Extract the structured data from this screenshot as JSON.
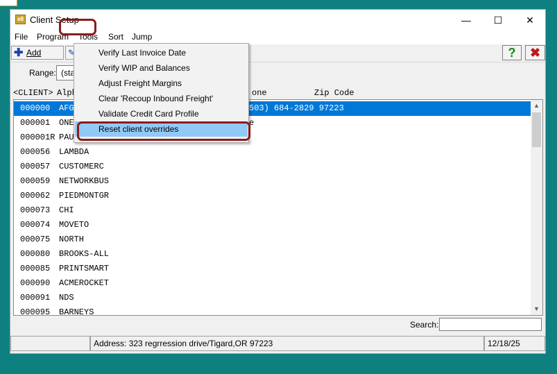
{
  "window": {
    "title": "Client Setup",
    "icon_text": "e8",
    "controls": {
      "minimize": "—",
      "maximize": "☐",
      "close": "✕"
    }
  },
  "menubar": [
    "File",
    "Program",
    "Tools",
    "Sort",
    "Jump"
  ],
  "toolbar": {
    "add_label": "Add",
    "add_icon": "plus-icon",
    "help_icon": "?",
    "close_icon": "✖"
  },
  "range": {
    "label": "Range:",
    "value": "(sta"
  },
  "columns": {
    "client": "<CLIENT>",
    "alpha": "Alph",
    "phone": "one",
    "zip": "Zip Code"
  },
  "rows": [
    {
      "code": "000000",
      "alpha": "AFG",
      "phone": "503) 684-2829 97223",
      "selected": true
    },
    {
      "code": "000001",
      "alpha": "ONE",
      "phone": "e"
    },
    {
      "code": "000001R",
      "alpha": "PAUL",
      "phone": ""
    },
    {
      "code": "000056",
      "alpha": "LAMBDA",
      "phone": ""
    },
    {
      "code": "000057",
      "alpha": "CUSTOMERC",
      "phone": ""
    },
    {
      "code": "000059",
      "alpha": "NETWORKBUS",
      "phone": ""
    },
    {
      "code": "000062",
      "alpha": "PIEDMONTGR",
      "phone": ""
    },
    {
      "code": "000073",
      "alpha": "CHI",
      "phone": ""
    },
    {
      "code": "000074",
      "alpha": "MOVETO",
      "phone": ""
    },
    {
      "code": "000075",
      "alpha": "NORTH",
      "phone": ""
    },
    {
      "code": "000080",
      "alpha": "BROOKS-ALL",
      "phone": ""
    },
    {
      "code": "000085",
      "alpha": "PRINTSMART",
      "phone": ""
    },
    {
      "code": "000090",
      "alpha": "ACMEROCKET",
      "phone": ""
    },
    {
      "code": "000091",
      "alpha": "NDS",
      "phone": ""
    },
    {
      "code": "000095",
      "alpha": "BARNEYS",
      "phone": ""
    }
  ],
  "tools_menu": [
    "Verify Last Invoice Date",
    "Verify WIP and Balances",
    "Adjust Freight Margins",
    "Clear 'Recoup Inbound Freight'",
    "Validate Credit Card Profile",
    "Reset client overrides"
  ],
  "search": {
    "label": "Search:",
    "value": ""
  },
  "status": {
    "left": "",
    "address": "Address: 323 regrression drive/Tigard,OR   97223",
    "date": "12/18/25"
  },
  "colors": {
    "selection": "#0078d7",
    "menu_hover": "#91c9f7",
    "annotation": "#8b1a1a",
    "desktop": "#0e8080"
  }
}
